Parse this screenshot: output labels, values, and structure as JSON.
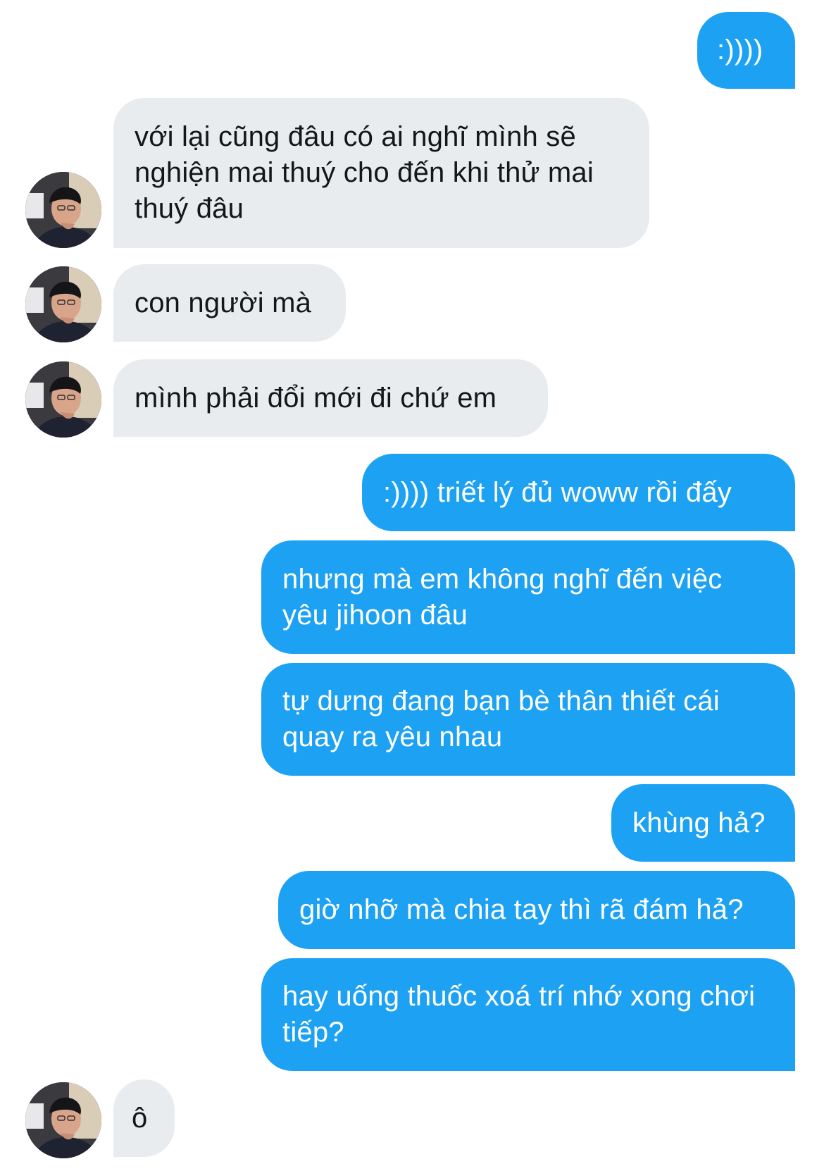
{
  "messages": [
    {
      "sender": "me",
      "text": ":))))"
    },
    {
      "sender": "them",
      "text": "với lại cũng đâu có ai nghĩ mình sẽ nghiện mai thuý cho đến khi thử mai thuý đâu"
    },
    {
      "sender": "them",
      "text": "con người mà"
    },
    {
      "sender": "them",
      "text": "mình phải đổi mới đi chứ em"
    },
    {
      "sender": "me",
      "text": ":)))) triết lý đủ woww rồi đấy"
    },
    {
      "sender": "me",
      "text": "nhưng mà em không nghĩ đến việc yêu jihoon đâu"
    },
    {
      "sender": "me",
      "text": "tự dưng đang bạn bè thân thiết cái quay ra yêu nhau"
    },
    {
      "sender": "me",
      "text": "khùng hả?"
    },
    {
      "sender": "me",
      "text": "giờ nhỡ mà chia tay thì rã đám hả?"
    },
    {
      "sender": "me",
      "text": "hay uống thuốc xoá trí nhớ xong chơi tiếp?"
    },
    {
      "sender": "them",
      "text": "ô"
    }
  ],
  "colors": {
    "outgoing_bubble": "#1da1f2",
    "incoming_bubble": "#e9ecef",
    "incoming_text": "#14171a",
    "outgoing_text": "#ffffff"
  },
  "avatar_icon": "user-avatar-photo"
}
